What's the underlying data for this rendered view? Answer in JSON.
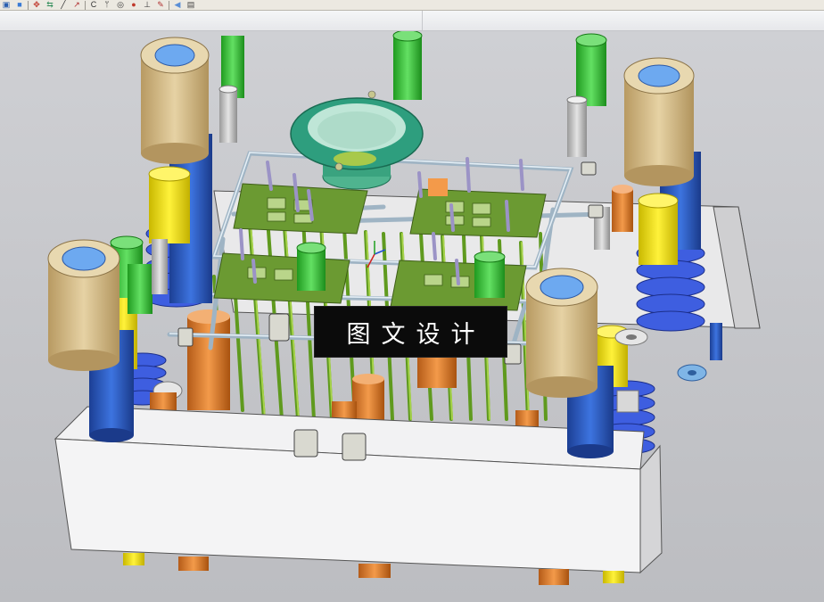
{
  "toolbar": {
    "tools": [
      {
        "icon": "part-icon",
        "glyph": "▣",
        "color": "#2a5fb0"
      },
      {
        "icon": "solid-icon",
        "glyph": "■",
        "color": "#3a7bd5"
      },
      {
        "icon": "assembly-icon",
        "glyph": "✥",
        "color": "#c0392b"
      },
      {
        "icon": "move-icon",
        "glyph": "⇆",
        "color": "#2e8b57"
      },
      {
        "icon": "line-icon",
        "glyph": "╱",
        "color": "#333333"
      },
      {
        "icon": "point-line-icon",
        "glyph": "↗",
        "color": "#b03030"
      },
      {
        "icon": "arc-icon",
        "glyph": "C",
        "color": "#333333"
      },
      {
        "icon": "axis-icon",
        "glyph": "ᛘ",
        "color": "#333333"
      },
      {
        "icon": "circle-icon",
        "glyph": "◎",
        "color": "#333333"
      },
      {
        "icon": "fillet-icon",
        "glyph": "●",
        "color": "#c0392b"
      },
      {
        "icon": "plane-icon",
        "glyph": "⊥",
        "color": "#333333"
      },
      {
        "icon": "sketch-icon",
        "glyph": "✎",
        "color": "#b03030"
      },
      {
        "icon": "view-icon",
        "glyph": "◀",
        "color": "#5b8fd6"
      },
      {
        "icon": "render-icon",
        "glyph": "▤",
        "color": "#444444"
      }
    ]
  },
  "watermark": {
    "text": "图文设计"
  },
  "colors": {
    "plate": "#f2f2f2",
    "guide_bushing": "#d8bf8e",
    "guide_pillar": "#2f5fc4",
    "ejector_pin": "#8fc23a",
    "socket_screw": "#3cc63c",
    "spring": "#3d5fd8",
    "yellow_pin": "#f2e21a",
    "orange_pin": "#e07d2c",
    "cooling_line": "#b7c9d6",
    "ring": "#2e9e7e",
    "cavity_insert": "#5e8c2a"
  }
}
